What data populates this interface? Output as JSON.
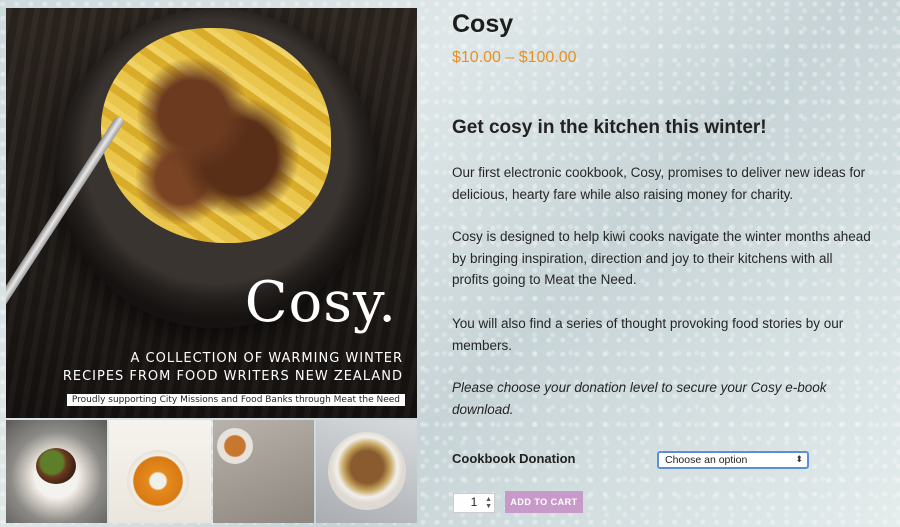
{
  "cover": {
    "title": "Cosy.",
    "subtitle_line1": "A COLLECTION OF WARMING WINTER",
    "subtitle_line2": "RECIPES FROM FOOD WRITERS NEW ZEALAND",
    "banner": "Proudly supporting City Missions and Food Banks through Meat the Need"
  },
  "product": {
    "title": "Cosy",
    "price": "$10.00 – $100.00",
    "subheading": "Get cosy in the kitchen this winter!",
    "paragraphs": [
      "Our first electronic cookbook, Cosy, promises to deliver new ideas for delicious, hearty fare while also raising money for charity.",
      "Cosy is designed to help kiwi cooks navigate the winter months ahead by bringing inspiration, direction and joy to their kitchens with all profits going to Meat the Need.",
      "You will also find a series of thought provoking food stories by our members.",
      "Please choose your donation level to secure your Cosy e-book download."
    ]
  },
  "variation": {
    "label": "Cookbook Donation",
    "selected": "Choose an option"
  },
  "cart": {
    "quantity": "1",
    "button_label": "ADD TO CART"
  },
  "icons": {
    "select_arrow": "chevron-updown-icon",
    "qty_spinner": "stepper-icon"
  },
  "colors": {
    "price": "#e8901f",
    "cart_button": "#c79ac9",
    "select_border": "#5b8fdc"
  }
}
